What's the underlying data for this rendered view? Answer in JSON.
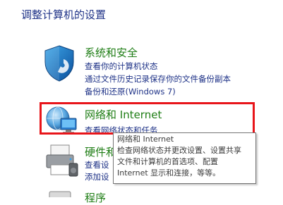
{
  "page": {
    "title": "调整计算机的设置"
  },
  "categories": [
    {
      "title": "系统和安全",
      "links": [
        "查看你的计算机状态",
        "通过文件历史记录保存你的文件备份副本",
        "备份和还原(Windows 7)"
      ],
      "icon": "shield-icon"
    },
    {
      "title": "网络和 Internet",
      "links": [
        "查看网络状态和任务"
      ],
      "icon": "globe-network-icon"
    },
    {
      "title": "硬件和",
      "links": [
        "查看设",
        "添加设"
      ],
      "icon": "printer-icon"
    },
    {
      "title": "程序",
      "icon": "programs-icon"
    }
  ],
  "tooltip": {
    "title": "网络和 Internet",
    "lines": [
      "检查网络状态并更改设置、设置共享",
      "文件和计算机的首选项、配置",
      "Internet 显示和连接，等等。"
    ]
  },
  "colors": {
    "heading": "#1e3287",
    "category": "#1e7d14",
    "link": "#1e3287",
    "highlight": "#e8151a"
  }
}
